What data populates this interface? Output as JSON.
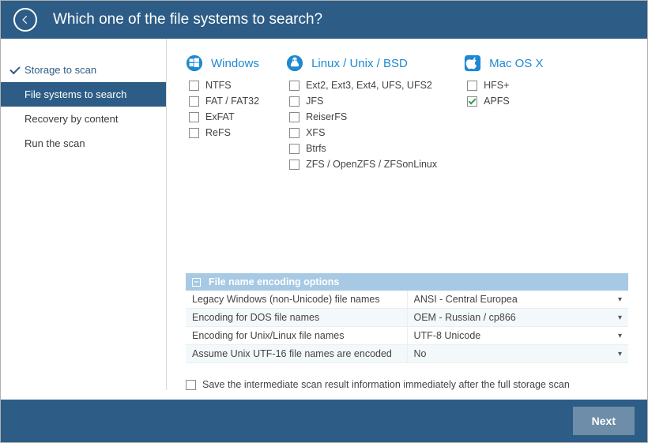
{
  "header": {
    "title": "Which one of the file systems to search?"
  },
  "sidebar": {
    "steps": [
      {
        "label": "Storage to scan",
        "state": "done"
      },
      {
        "label": "File systems to search",
        "state": "active"
      },
      {
        "label": "Recovery by content",
        "state": "pending"
      },
      {
        "label": "Run the scan",
        "state": "pending"
      }
    ]
  },
  "filesystems": {
    "windows": {
      "heading": "Windows",
      "items": [
        {
          "label": "NTFS",
          "checked": false
        },
        {
          "label": "FAT / FAT32",
          "checked": false
        },
        {
          "label": "ExFAT",
          "checked": false
        },
        {
          "label": "ReFS",
          "checked": false
        }
      ]
    },
    "linux": {
      "heading": "Linux / Unix / BSD",
      "items": [
        {
          "label": "Ext2, Ext3, Ext4, UFS, UFS2",
          "checked": false
        },
        {
          "label": "JFS",
          "checked": false
        },
        {
          "label": "ReiserFS",
          "checked": false
        },
        {
          "label": "XFS",
          "checked": false
        },
        {
          "label": "Btrfs",
          "checked": false
        },
        {
          "label": "ZFS / OpenZFS / ZFSonLinux",
          "checked": false
        }
      ]
    },
    "mac": {
      "heading": "Mac OS X",
      "items": [
        {
          "label": "HFS+",
          "checked": false
        },
        {
          "label": "APFS",
          "checked": true
        }
      ]
    }
  },
  "encoding": {
    "heading": "File name encoding options",
    "rows": [
      {
        "label": "Legacy Windows (non-Unicode) file names",
        "value": "ANSI - Central Europea"
      },
      {
        "label": "Encoding for DOS file names",
        "value": "OEM - Russian / cp866"
      },
      {
        "label": "Encoding for Unix/Linux file names",
        "value": "UTF-8 Unicode"
      },
      {
        "label": "Assume Unix UTF-16 file names are encoded",
        "value": "No"
      }
    ]
  },
  "save_intermediate": {
    "label": "Save the intermediate scan result information immediately after the full storage scan",
    "checked": false
  },
  "footer": {
    "next": "Next"
  }
}
